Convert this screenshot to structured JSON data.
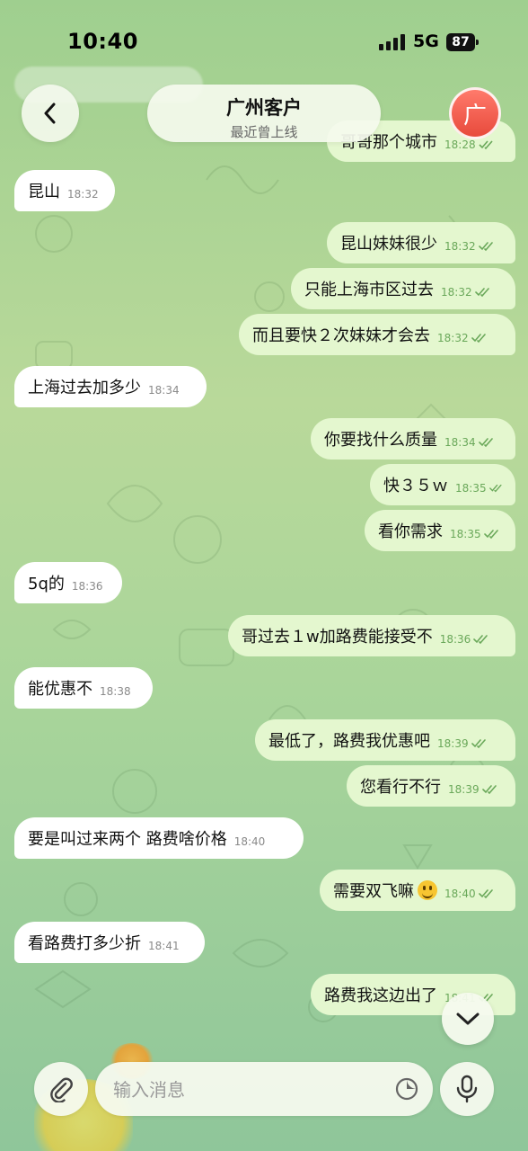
{
  "status_bar": {
    "time": "10:40",
    "network": "5G",
    "battery": "87"
  },
  "header": {
    "title": "广州客户",
    "subtitle": "最近曾上线",
    "avatar_letter": "广"
  },
  "partial_top": {
    "text": "哥哥那个城市",
    "time": "18:28"
  },
  "messages": [
    {
      "dir": "in",
      "text": "昆山",
      "time": "18:32"
    },
    {
      "dir": "out",
      "text": "昆山妹妹很少",
      "time": "18:32"
    },
    {
      "dir": "out",
      "text": "只能上海市区过去",
      "time": "18:32"
    },
    {
      "dir": "out",
      "text": "而且要快２次妹妹才会去",
      "time": "18:32"
    },
    {
      "dir": "in",
      "text": "上海过去加多少",
      "time": "18:34"
    },
    {
      "dir": "out",
      "text": "你要找什么质量",
      "time": "18:34"
    },
    {
      "dir": "out",
      "text": "快３５ｗ",
      "time": "18:35"
    },
    {
      "dir": "out",
      "text": "看你需求",
      "time": "18:35"
    },
    {
      "dir": "in",
      "text": "5q的",
      "time": "18:36"
    },
    {
      "dir": "out",
      "text": "哥过去１w加路费能接受不",
      "time": "18:36"
    },
    {
      "dir": "in",
      "text": "能优惠不",
      "time": "18:38"
    },
    {
      "dir": "out",
      "text": "最低了，路费我优惠吧",
      "time": "18:39"
    },
    {
      "dir": "out",
      "text": "您看行不行",
      "time": "18:39"
    },
    {
      "dir": "in",
      "text": "要是叫过来两个 路费啥价格",
      "time": "18:40"
    },
    {
      "dir": "out",
      "text": "需要双飞嘛",
      "time": "18:40",
      "emoji": "grinning-emoji"
    },
    {
      "dir": "in",
      "text": "看路费打多少折",
      "time": "18:41"
    },
    {
      "dir": "out",
      "text": "路费我这边出了",
      "time": "18:41"
    }
  ],
  "composer": {
    "placeholder": "输入消息"
  },
  "colors": {
    "incoming": "#ffffff",
    "outgoing": "#e4f7cf",
    "avatar": "#e84a3c",
    "check": "#6aa85a"
  }
}
